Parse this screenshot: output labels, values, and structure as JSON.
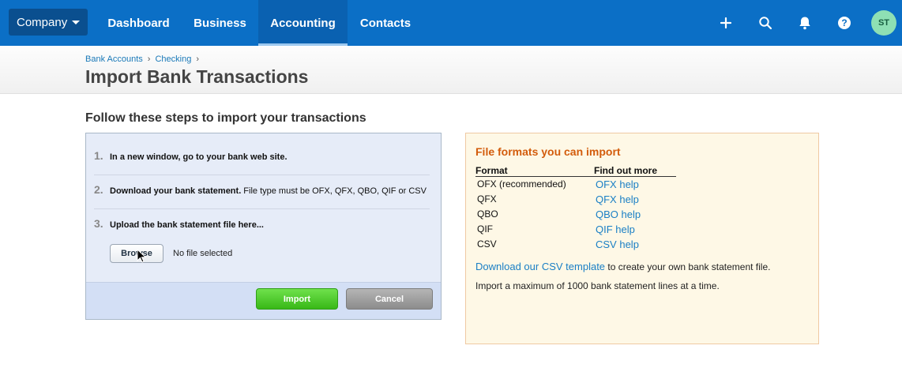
{
  "nav": {
    "company": "Company",
    "items": [
      {
        "label": "Dashboard"
      },
      {
        "label": "Business"
      },
      {
        "label": "Accounting"
      },
      {
        "label": "Contacts"
      }
    ],
    "avatar": "ST",
    "icons": [
      "plus-icon",
      "search-icon",
      "bell-icon",
      "help-icon"
    ]
  },
  "breadcrumb": [
    "Bank Accounts",
    "Checking"
  ],
  "page_title": "Import Bank Transactions",
  "steps_heading": "Follow these steps to import your transactions",
  "steps": [
    {
      "num": "1.",
      "bold": "In a new window, go to your bank web site.",
      "rest": ""
    },
    {
      "num": "2.",
      "bold": "Download your bank statement.",
      "rest": " File type must be OFX, QFX, QBO, QIF or CSV"
    },
    {
      "num": "3.",
      "bold": "Upload the bank statement file here...",
      "rest": ""
    }
  ],
  "browse_label": "Browse",
  "no_file": "No file selected",
  "import_label": "Import",
  "cancel_label": "Cancel",
  "formats": {
    "title": "File formats you can import",
    "col_format": "Format",
    "col_help": "Find out more",
    "rows": [
      {
        "format": "OFX (recommended)",
        "help": "OFX help"
      },
      {
        "format": "QFX",
        "help": "QFX help"
      },
      {
        "format": "QBO",
        "help": "QBO help"
      },
      {
        "format": "QIF",
        "help": "QIF help"
      },
      {
        "format": "CSV",
        "help": "CSV help"
      }
    ],
    "csv_link": "Download our CSV template",
    "csv_rest": " to create your own bank statement file.",
    "max_line": "Import a maximum of 1000 bank statement lines at a time."
  },
  "colors": {
    "topbar": "#0b6fc6",
    "accent_orange": "#d35c0c",
    "link": "#1a7fc5",
    "import_green": "#4ccc2a"
  }
}
